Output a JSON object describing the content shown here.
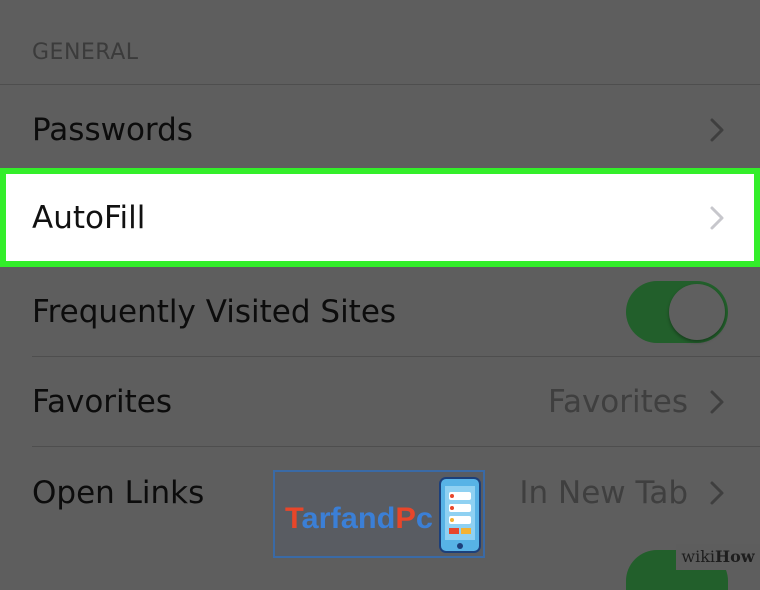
{
  "section": {
    "header": "GENERAL"
  },
  "rows": {
    "passwords": {
      "label": "Passwords"
    },
    "autofill": {
      "label": "AutoFill"
    },
    "frequent": {
      "label": "Frequently Visited Sites",
      "toggle_on": true
    },
    "favorites": {
      "label": "Favorites",
      "value": "Favorites"
    },
    "open_links": {
      "label": "Open Links",
      "value": "In New Tab"
    }
  },
  "colors": {
    "highlight_border": "#33ee2a",
    "toggle_on": "#225f2b",
    "dim_background": "#5e5e5e"
  },
  "watermarks": {
    "tarfandpc": "TarfandPc",
    "wikihow_prefix": "wiki",
    "wikihow_suffix": "How"
  }
}
